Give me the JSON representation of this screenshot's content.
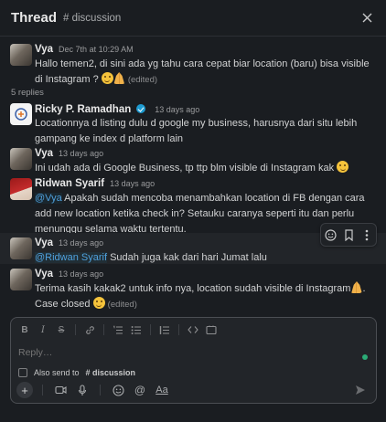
{
  "header": {
    "title": "Thread",
    "channel": "# discussion"
  },
  "root_message": {
    "author": "Vya",
    "time": "Dec 7th at 10:29 AM",
    "text": "Hallo temen2, di sini ada yg tahu cara cepat biar location (baru) bisa visible di Instagram ?",
    "edited": "(edited)"
  },
  "replies_count": "5 replies",
  "replies": [
    {
      "author": "Ricky P. Ramadhan",
      "time": "13 days ago",
      "text": "Locationnya d listing dulu d google my business, harusnya dari situ lebih gampang ke index d platform lain"
    },
    {
      "author": "Vya",
      "time": "13 days ago",
      "text": "Ini udah ada di Google Business, tp ttp blm visible di Instagram kak"
    },
    {
      "author": "Ridwan Syarif",
      "time": "13 days ago",
      "mention": "@Vya",
      "text": " Apakah sudah mencoba menambahkan location di FB dengan cara add new location ketika check in? Setauku caranya seperti itu dan perlu menunggu selama waktu tertentu."
    },
    {
      "author": "Vya",
      "time": "13 days ago",
      "mention": "@Ridwan Syarif",
      "text": " Sudah juga kak dari hari Jumat lalu"
    },
    {
      "author": "Vya",
      "time": "13 days ago",
      "text": "Terima kasih kakak2 untuk info nya, location sudah visible di Instagram",
      "text2": ". Case closed",
      "edited": "(edited)"
    }
  ],
  "composer": {
    "placeholder": "Reply…",
    "also_send_prefix": "Also send to",
    "also_send_channel": "# discussion",
    "format_label": "Aa"
  },
  "icons": {
    "close": "close-icon",
    "bold": "bold-icon",
    "italic": "italic-icon",
    "strike": "strikethrough-icon",
    "link": "link-icon",
    "ordered_list": "ordered-list-icon",
    "bullet_list": "bullet-list-icon",
    "blockquote": "blockquote-icon",
    "code": "code-icon",
    "code_block": "code-block-icon",
    "add_reaction": "add-reaction-icon",
    "bookmark": "bookmark-icon",
    "more": "more-icon",
    "plus": "plus-icon",
    "video": "video-icon",
    "mic": "microphone-icon",
    "emoji": "emoji-icon",
    "mention": "mention-icon",
    "send": "send-icon"
  },
  "colors": {
    "background": "#1a1d21",
    "mention": "#4fa0dd",
    "verified": "#1d9bd1",
    "online": "#2bac76"
  }
}
